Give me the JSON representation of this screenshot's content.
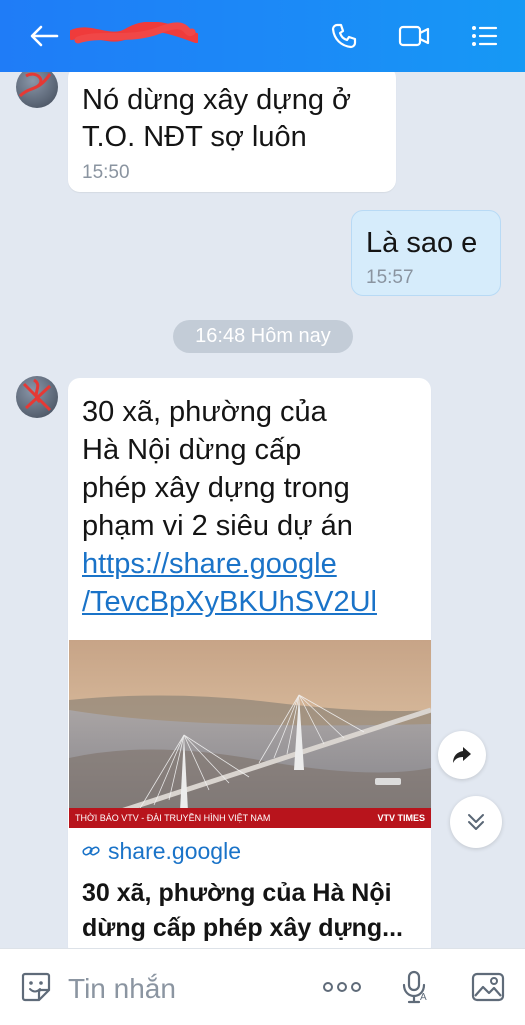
{
  "header": {
    "contact_name_redacted": true,
    "icons": [
      "back-arrow-icon",
      "phone-icon",
      "video-call-icon",
      "menu-icon"
    ]
  },
  "messages": [
    {
      "side": "in",
      "text_lines": [
        "Nó dừng xây dựng ở",
        "T.O. NĐT sợ luôn"
      ],
      "time": "15:50"
    },
    {
      "side": "out",
      "text_lines": [
        "Là sao e"
      ],
      "time": "15:57"
    }
  ],
  "date_separator": "16:48 Hôm nay",
  "link_message": {
    "text_lines": [
      "30 xã, phường của",
      "Hà Nội dừng cấp",
      "phép xây dựng trong",
      "phạm vi 2 siêu dự án"
    ],
    "url_lines": [
      "https://share.google",
      "/TevcBpXyBKUhSV2Ul"
    ],
    "preview": {
      "image_caption_left": "THỜI BÁO VTV - ĐÀI TRUYỀN HÌNH VIỆT NAM",
      "image_caption_right": "VTV TIMES",
      "domain": "share.google",
      "title_lines": [
        "30 xã, phường của Hà Nội",
        "dừng cấp phép xây dựng..."
      ]
    }
  },
  "composer": {
    "placeholder": "Tin nhắn",
    "icons": [
      "sticker-icon",
      "more-icon",
      "voice-icon",
      "gallery-icon"
    ]
  },
  "colors": {
    "header": "#1f7cf7",
    "chat_bg": "#e2e8f1",
    "outgoing_bubble": "#d6ecfb",
    "link": "#1a73c8"
  }
}
